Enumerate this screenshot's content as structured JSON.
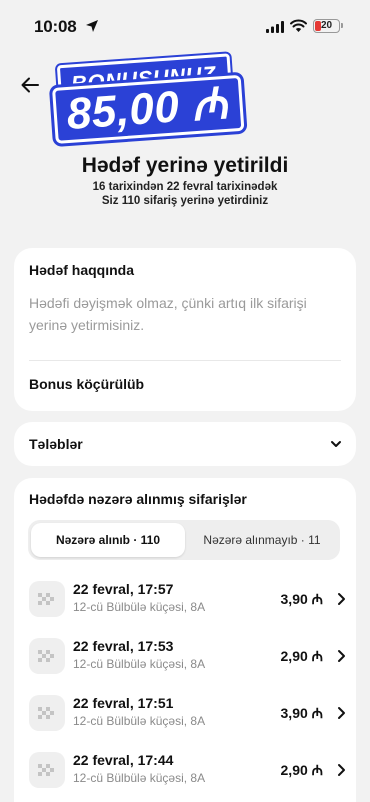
{
  "status": {
    "time": "10:08",
    "battery": "20"
  },
  "badge": {
    "line1": "BONUSUNUZ",
    "amount": "85,00 ₼"
  },
  "goal": {
    "title": "Hədəf yerinə yetirildi",
    "line1": "16 tarixindən 22 fevral tarixinədək",
    "line2": "Siz 110 sifariş yerinə yetirdiniz"
  },
  "about": {
    "title": "Hədəf haqqında",
    "text": "Hədəfi dəyişmək olmaz, çünki artıq ilk sifarişi yerinə yetirmisiniz.",
    "status": "Bonus köçürülüb"
  },
  "requirements": {
    "label": "Tələblər"
  },
  "orders": {
    "title": "Hədəfdə nəzərə alınmış sifarişlər",
    "tab_counted": "Nəzərə alınıb · 110",
    "tab_not_counted": "Nəzərə alınmayıb · 11",
    "items": [
      {
        "date": "22 fevral, 17:57",
        "address": "12-cü Bülbülə küçəsi, 8A",
        "price": "3,90 ₼"
      },
      {
        "date": "22 fevral, 17:53",
        "address": "12-cü Bülbülə küçəsi, 8A",
        "price": "2,90 ₼"
      },
      {
        "date": "22 fevral, 17:51",
        "address": "12-cü Bülbülə küçəsi, 8A",
        "price": "3,90 ₼"
      },
      {
        "date": "22 fevral, 17:44",
        "address": "12-cü Bülbülə küçəsi, 8A",
        "price": "2,90 ₼"
      }
    ]
  },
  "colors": {
    "badge": "#2b41d6",
    "battery_low": "#e53935"
  }
}
